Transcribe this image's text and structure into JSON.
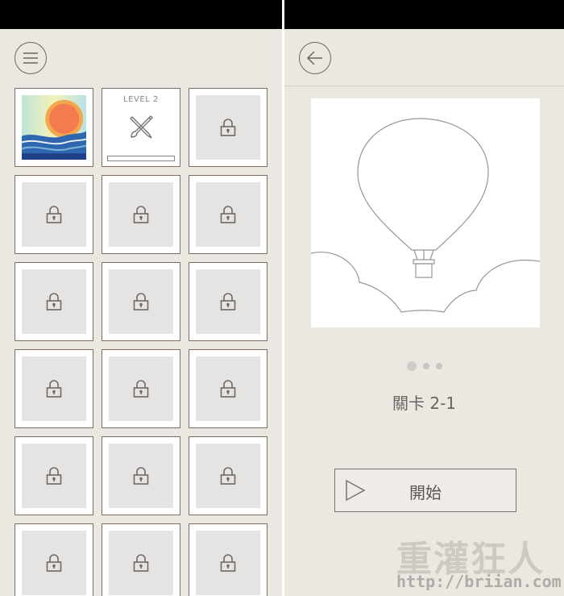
{
  "left_panel": {
    "menu_icon": "hamburger-menu-icon",
    "levels": [
      {
        "label": "",
        "state": "completed",
        "icon": "sunset-art-icon"
      },
      {
        "label": "LEVEL 2",
        "state": "current",
        "icon": "pencil-brush-crossed-icon",
        "progress": 0
      },
      {
        "label": "",
        "state": "locked",
        "icon": "lock-icon"
      },
      {
        "label": "",
        "state": "locked",
        "icon": "lock-icon"
      },
      {
        "label": "",
        "state": "locked",
        "icon": "lock-icon"
      },
      {
        "label": "",
        "state": "locked",
        "icon": "lock-icon"
      },
      {
        "label": "",
        "state": "locked",
        "icon": "lock-icon"
      },
      {
        "label": "",
        "state": "locked",
        "icon": "lock-icon"
      },
      {
        "label": "",
        "state": "locked",
        "icon": "lock-icon"
      },
      {
        "label": "",
        "state": "locked",
        "icon": "lock-icon"
      },
      {
        "label": "",
        "state": "locked",
        "icon": "lock-icon"
      },
      {
        "label": "",
        "state": "locked",
        "icon": "lock-icon"
      },
      {
        "label": "",
        "state": "locked",
        "icon": "lock-icon"
      },
      {
        "label": "",
        "state": "locked",
        "icon": "lock-icon"
      },
      {
        "label": "",
        "state": "locked",
        "icon": "lock-icon"
      },
      {
        "label": "",
        "state": "locked",
        "icon": "lock-icon"
      },
      {
        "label": "",
        "state": "locked",
        "icon": "lock-icon"
      },
      {
        "label": "",
        "state": "locked",
        "icon": "lock-icon"
      }
    ]
  },
  "right_panel": {
    "back_icon": "back-arrow-icon",
    "preview_icon": "hot-air-balloon-outline",
    "page_dots": {
      "count": 3,
      "active": 1
    },
    "stage_label": "關卡 2-1",
    "start_button": {
      "label": "開始",
      "icon": "play-triangle-icon"
    }
  },
  "watermark": {
    "title": "重灌狂人",
    "url": "http://briian.com"
  },
  "colors": {
    "panel_bg": "#ebe7e1",
    "cell_border": "#7d6f66",
    "locked_fill": "#e6e4e2"
  }
}
